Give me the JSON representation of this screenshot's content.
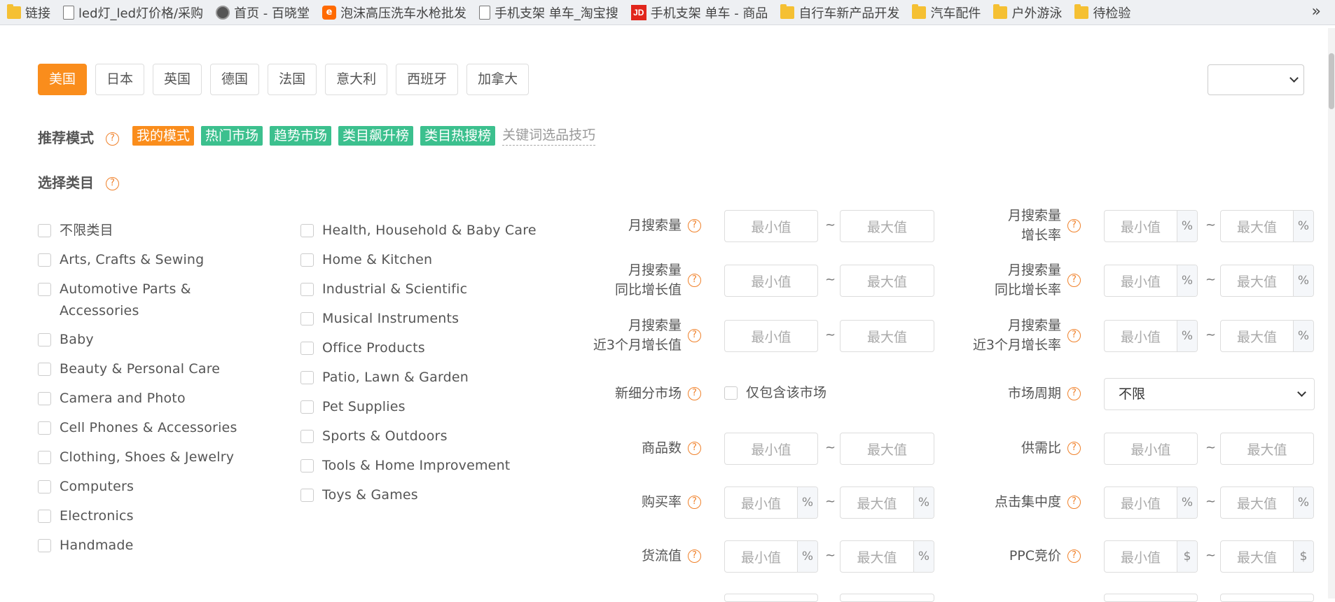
{
  "bookmarks": [
    {
      "label": "链接",
      "icon": "folder-icon"
    },
    {
      "label": "led灯_led灯价格/采购",
      "icon": "page-icon"
    },
    {
      "label": "首页 - 百晓堂",
      "icon": "site-icon"
    },
    {
      "label": "泡沫高压洗车水枪批发",
      "icon": "alibaba-icon"
    },
    {
      "label": "手机支架 单车_淘宝搜",
      "icon": "page-icon"
    },
    {
      "label": "手机支架 单车 - 商品",
      "icon": "jd-icon"
    },
    {
      "label": "自行车新产品开发",
      "icon": "folder-icon"
    },
    {
      "label": "汽车配件",
      "icon": "folder-icon"
    },
    {
      "label": "户外游泳",
      "icon": "folder-icon"
    },
    {
      "label": "待检验",
      "icon": "folder-icon"
    }
  ],
  "bookmarks_more": "»",
  "countries": [
    "美国",
    "日本",
    "英国",
    "德国",
    "法国",
    "意大利",
    "西班牙",
    "加拿大"
  ],
  "active_country": "美国",
  "top_select_value": "",
  "help_glyph": "?",
  "recommend": {
    "label": "推荐模式",
    "modes": [
      "我的模式",
      "热门市场",
      "趋势市场",
      "类目飙升榜",
      "类目热搜榜"
    ],
    "tip_link": "关键词选品技巧"
  },
  "category": {
    "label": "选择类目",
    "col1": [
      "不限类目",
      "Arts, Crafts & Sewing",
      "Automotive Parts &",
      "Accessories",
      "Baby",
      "Beauty & Personal Care",
      "Camera and Photo",
      "Cell Phones & Accessories",
      "Clothing, Shoes & Jewelry",
      "Computers",
      "Electronics",
      "Handmade"
    ],
    "col2": [
      "Health, Household & Baby Care",
      "Home & Kitchen",
      "Industrial & Scientific",
      "Musical Instruments",
      "Office Products",
      "Patio, Lawn & Garden",
      "Pet Supplies",
      "Sports & Outdoors",
      "Tools & Home Improvement",
      "Toys & Games"
    ]
  },
  "filters": {
    "min_placeholder": "最小值",
    "max_placeholder": "最大值",
    "tilde": "~",
    "percent": "%",
    "dollar": "$",
    "monthly_search": "月搜索量",
    "monthly_search_growth_l1": "月搜索量",
    "monthly_search_growth_l2": "增长率",
    "yoy_value_l1": "月搜索量",
    "yoy_value_l2": "同比增长值",
    "yoy_rate_l1": "月搜索量",
    "yoy_rate_l2": "同比增长率",
    "q3_value_l1": "月搜索量",
    "q3_value_l2": "近3个月增长值",
    "q3_rate_l1": "月搜索量",
    "q3_rate_l2": "近3个月增长率",
    "new_segment": "新细分市场",
    "only_contains": "仅包含该市场",
    "market_cycle": "市场周期",
    "market_cycle_value": "不限",
    "product_count": "商品数",
    "supply_demand": "供需比",
    "purchase_rate": "购买率",
    "click_concentration": "点击集中度",
    "goods_flow": "货流值",
    "ppc_bid": "PPC竞价"
  }
}
